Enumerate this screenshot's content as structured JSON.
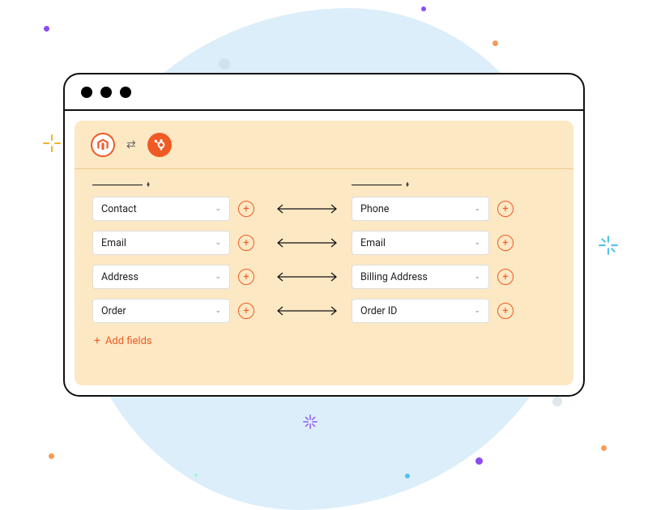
{
  "integrations": {
    "left_service": "magento",
    "right_service": "hubspot"
  },
  "mapping": {
    "rows": [
      {
        "left": "Contact",
        "right": "Phone"
      },
      {
        "left": "Email",
        "right": "Email"
      },
      {
        "left": "Address",
        "right": "Billing Address"
      },
      {
        "left": "Order",
        "right": "Order ID"
      }
    ],
    "add_fields_label": "Add fields"
  },
  "colors": {
    "accent": "#f05a24",
    "panel_bg": "#fde8c4",
    "blob_bg": "#dbeefa"
  }
}
